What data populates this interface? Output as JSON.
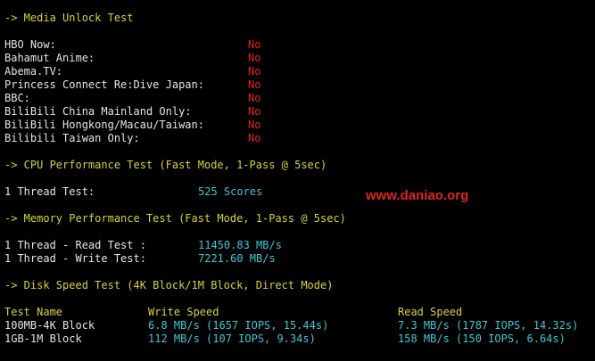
{
  "media": {
    "header": "-> Media Unlock Test",
    "rows": [
      {
        "label": "HBO Now:",
        "status": "No"
      },
      {
        "label": "Bahamut Anime:",
        "status": "No"
      },
      {
        "label": "Abema.TV:",
        "status": "No"
      },
      {
        "label": "Princess Connect Re:Dive Japan:",
        "status": "No"
      },
      {
        "label": "BBC:",
        "status": "No"
      },
      {
        "label": "BiliBili China Mainland Only:",
        "status": "No"
      },
      {
        "label": "BiliBili Hongkong/Macau/Taiwan:",
        "status": "No"
      },
      {
        "label": "Bilibili Taiwan Only:",
        "status": "No"
      }
    ]
  },
  "cpu": {
    "header": "-> CPU Performance Test (Fast Mode, 1-Pass @ 5sec)",
    "row": {
      "label": "1 Thread Test:",
      "value": "525 Scores"
    }
  },
  "watermark": "www.daniao.org",
  "memory": {
    "header": "-> Memory Performance Test (Fast Mode, 1-Pass @ 5sec)",
    "rows": [
      {
        "label": "1 Thread - Read Test :",
        "value": "11450.83 MB/s"
      },
      {
        "label": "1 Thread - Write Test:",
        "value": "7221.60 MB/s"
      }
    ]
  },
  "disk": {
    "header": "-> Disk Speed Test (4K Block/1M Block, Direct Mode)",
    "columns": {
      "name": "Test Name",
      "write": "Write Speed",
      "read": "Read Speed"
    },
    "rows": [
      {
        "name": "100MB-4K Block",
        "write": "6.8 MB/s (1657 IOPS, 15.44s)",
        "read": "7.3 MB/s (1787 IOPS, 14.32s)"
      },
      {
        "name": "1GB-1M Block",
        "write": "112 MB/s (107 IOPS, 9.34s)",
        "read": "158 MB/s (150 IOPS, 6.64s)"
      }
    ]
  },
  "colors": {
    "background": "#000000",
    "header": "#d8d23a",
    "text": "#e5e5e5",
    "fail": "#e0261f",
    "value": "#3ec8d8",
    "watermark": "#e0261f"
  }
}
